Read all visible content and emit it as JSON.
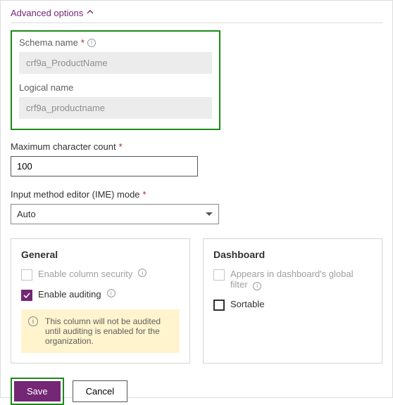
{
  "header": {
    "advanced_label": "Advanced options"
  },
  "schema": {
    "name_label": "Schema name",
    "name_value": "crf9a_ProductName",
    "logical_label": "Logical name",
    "logical_value": "crf9a_productname"
  },
  "max_count": {
    "label": "Maximum character count",
    "value": "100"
  },
  "ime": {
    "label": "Input method editor (IME) mode",
    "value": "Auto"
  },
  "general": {
    "title": "General",
    "col_security": "Enable column security",
    "auditing": "Enable auditing",
    "warning": "This column will not be audited until auditing is enabled for the organization."
  },
  "dashboard": {
    "title": "Dashboard",
    "global_filter": "Appears in dashboard's global filter",
    "sortable": "Sortable"
  },
  "buttons": {
    "save": "Save",
    "cancel": "Cancel"
  }
}
